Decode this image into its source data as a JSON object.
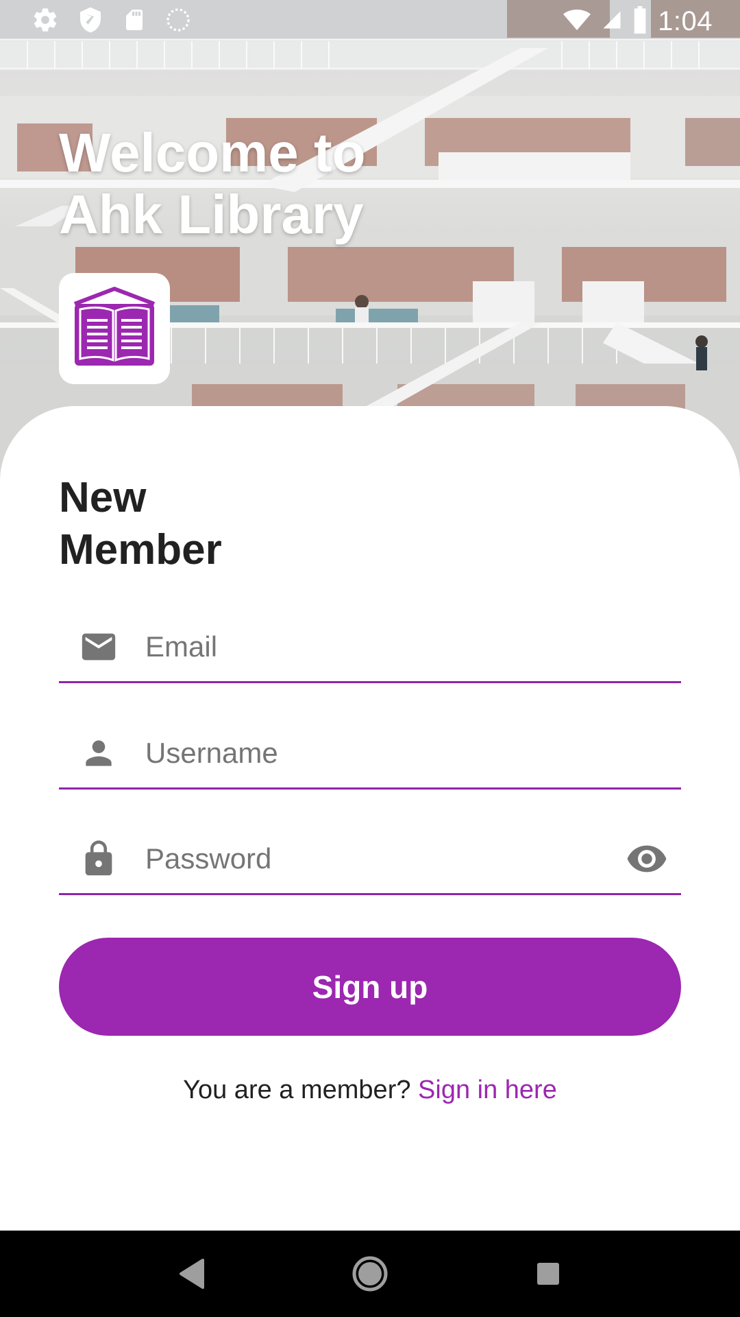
{
  "status_bar": {
    "time": "1:04",
    "left_icons": [
      "gear-icon",
      "shield-icon",
      "sd-card-icon",
      "sync-circle-icon"
    ],
    "right_icons": [
      "wifi-icon",
      "cell-signal-icon",
      "battery-icon"
    ]
  },
  "header": {
    "welcome_line1": "Welcome to",
    "welcome_line2": "Ahk Library",
    "logo_icon": "open-book-icon"
  },
  "form": {
    "title_line1": "New",
    "title_line2": "Member",
    "email": {
      "placeholder": "Email",
      "value": "",
      "icon": "email-icon"
    },
    "username": {
      "placeholder": "Username",
      "value": "",
      "icon": "person-icon"
    },
    "password": {
      "placeholder": "Password",
      "value": "",
      "icon": "lock-icon",
      "toggle_icon": "eye-icon"
    },
    "signup_label": "Sign up",
    "member_prompt": "You are a member?",
    "signin_link": "Sign in here"
  },
  "nav": {
    "icons": [
      "back-icon",
      "home-icon",
      "recents-icon"
    ]
  },
  "colors": {
    "accent": "#9c27b0",
    "underline": "#8e24aa",
    "text": "#212121",
    "placeholder": "#757575"
  }
}
